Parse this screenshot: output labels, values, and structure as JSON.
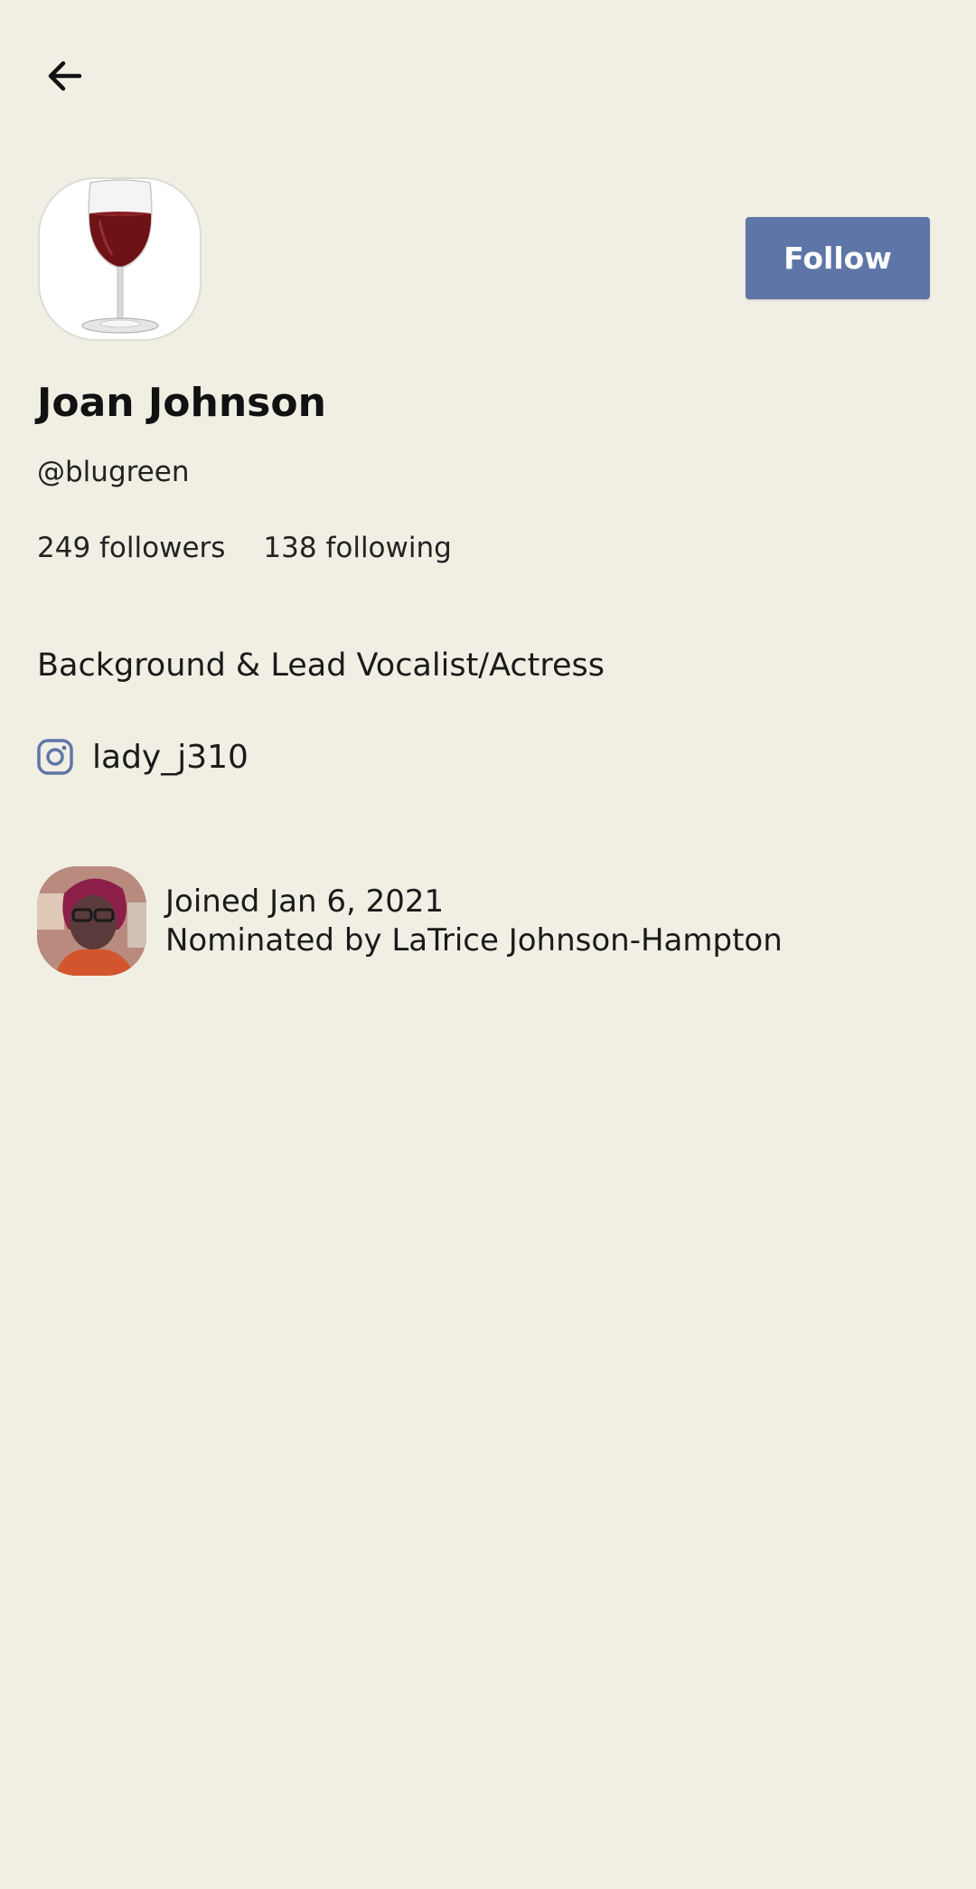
{
  "header": {
    "back_icon": "arrow-left-icon"
  },
  "profile": {
    "avatar_icon": "wine-glass-image",
    "name": "Joan Johnson",
    "handle": "@blugreen",
    "followers": "249 followers",
    "following": "138 following",
    "bio": "Background & Lead Vocalist/Actress",
    "follow_label": "Follow"
  },
  "social": {
    "icon": "instagram-icon",
    "username": "lady_j310"
  },
  "joined": {
    "date_text": "Joined Jan 6, 2021",
    "nominated_text": "Nominated by LaTrice Johnson-Hampton"
  },
  "colors": {
    "background": "#f1efe4",
    "accent": "#5e76a7",
    "text": "#1a1a1a"
  }
}
